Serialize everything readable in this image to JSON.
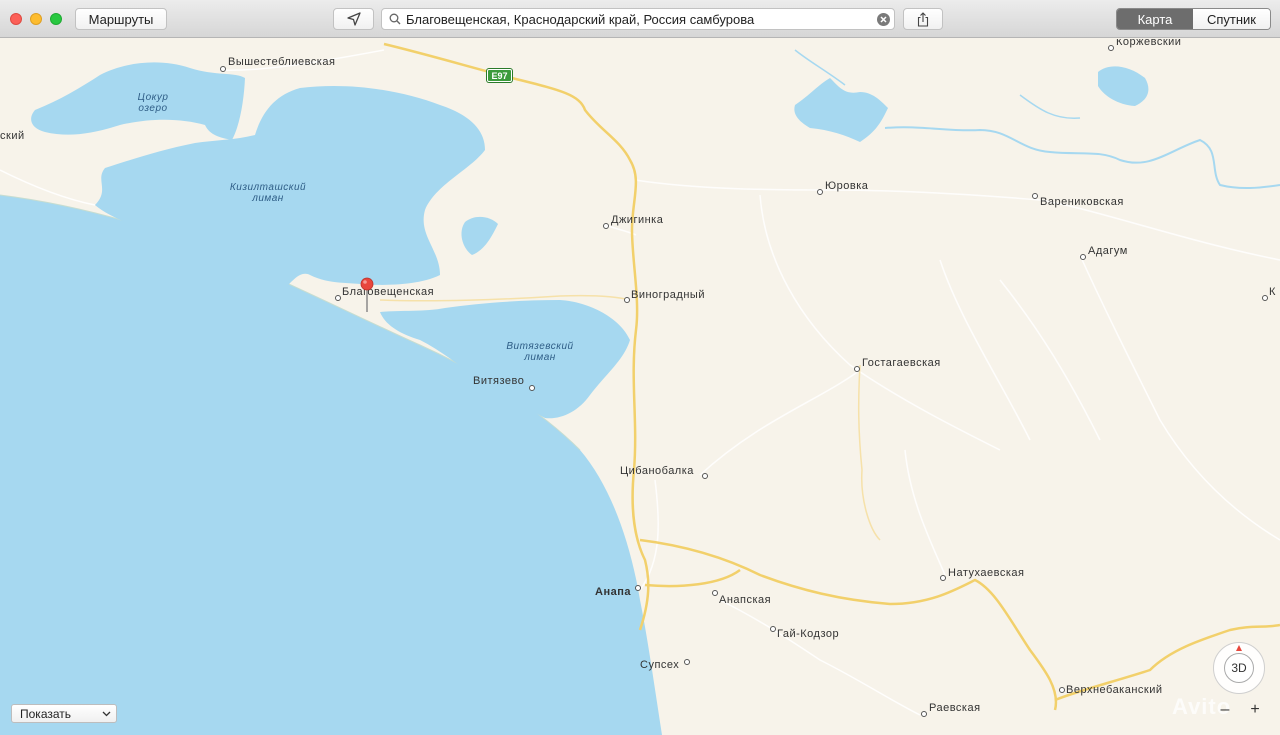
{
  "toolbar": {
    "routes_label": "Маршруты",
    "search_value": "Благовещенская, Краснодарский край, Россия самбурова",
    "view_map_label": "Карта",
    "view_satellite_label": "Спутник"
  },
  "map": {
    "road_shield": "E97",
    "places": {
      "vyshesteblievskaya": "Вышестеблиевская",
      "skiy": "ский",
      "korzhevsky": "Коржевский",
      "yurovka": "Юровка",
      "varenikovskaya": "Варениковская",
      "dzhiginka": "Джигинка",
      "adagum": "Адагум",
      "blagoveshchenskaya": "Благовещенская",
      "vinogradny": "Виноградный",
      "k_cut": "К",
      "gostagaevskaya": "Гостагаевская",
      "vityazevo": "Витязево",
      "tsibanobalka": "Цибанобалка",
      "natukhaevskaya": "Натухаевская",
      "anapa": "Анапа",
      "anapskaya": "Анапская",
      "gai_kodzor": "Гай-Кодзор",
      "supsekh": "Супсех",
      "verkhnebakansky": "Верхнебаканский",
      "raevskaya": "Раевская"
    },
    "water": {
      "tsokur_1": "Цокур",
      "tsokur_2": "озеро",
      "kiziltash_1": "Кизилташский",
      "kiziltash_2": "лиман",
      "vityazev_1": "Витязевский",
      "vityazev_2": "лиман"
    },
    "show_select": "Показать",
    "compass_label": "3D",
    "zoom_out": "–",
    "zoom_in": "+",
    "watermark": "Avito"
  },
  "colors": {
    "land": "#f7f3ea",
    "water": "#a6d8f0",
    "road_major": "#f2d06b",
    "road_minor": "#ffffff",
    "pin": "#e8463c"
  }
}
